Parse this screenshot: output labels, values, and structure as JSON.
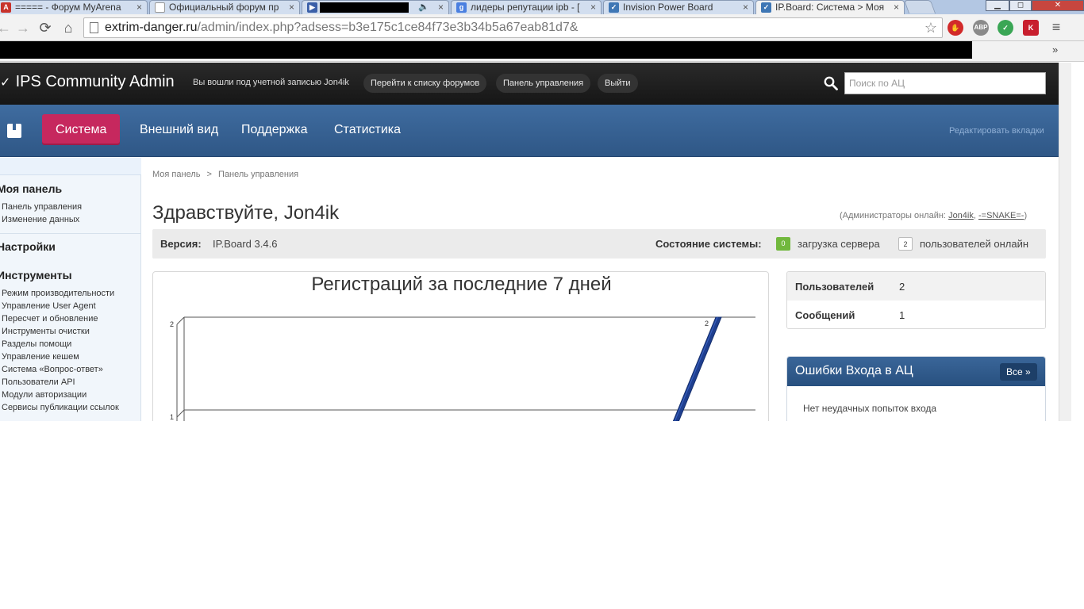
{
  "browser": {
    "tabs": [
      {
        "title": "===== - Форум MyArena",
        "favicon": "myarena-icon",
        "favicon_color": "#c8332b",
        "active": false
      },
      {
        "title": "Официальный форум пр",
        "favicon": "page-icon",
        "favicon_color": "#ffffff",
        "active": false
      },
      {
        "title": "",
        "favicon": "play-icon",
        "favicon_color": "#3a5fa8",
        "active": false,
        "redacted": true,
        "audio": "🔈"
      },
      {
        "title": "лидеры репутации ipb - [",
        "favicon": "google-icon",
        "favicon_color": "#4a7fe0",
        "active": false
      },
      {
        "title": "Invision Power Board",
        "favicon": "ipb-icon",
        "favicon_color": "#3f77b5",
        "active": false
      },
      {
        "title": "IP.Board: Система > Моя",
        "favicon": "ipb-icon",
        "favicon_color": "#3f77b5",
        "active": true
      }
    ],
    "tab_close": "×",
    "window_buttons": [
      "▁",
      "◻",
      "✕"
    ],
    "url": "extrim-danger.ru/admin/index.php?adsess=b3e175c1ce84f73e3b34b5a67eab81d7&",
    "url_domain": "extrim-danger.ru",
    "url_path": "/admin/index.php?adsess=b3e175c1ce84f73e3b34b5a67eab81d7&",
    "extensions": [
      {
        "name": "adblock-icon",
        "label": "",
        "color": "#d22a2a"
      },
      {
        "name": "abp-icon",
        "label": "ABP",
        "color": "#8a8a8a"
      },
      {
        "name": "shield-check-icon",
        "label": "✓",
        "color": "#3aa655"
      },
      {
        "name": "kaspersky-icon",
        "label": "K",
        "color": "#c81f2e"
      }
    ],
    "bookmarks_more": "»"
  },
  "header": {
    "logo": "IPS Community Admin",
    "logged_in": "Вы вошли под учетной записью Jon4ik",
    "buttons": {
      "forums": "Перейти к списку форумов",
      "panel": "Панель управления",
      "logout": "Выйти"
    },
    "search_placeholder": "Поиск по АЦ"
  },
  "nav": {
    "tabs": [
      "Система",
      "Внешний вид",
      "Поддержка",
      "Статистика"
    ],
    "active": "Система",
    "edit_tabs": "Редактировать вкладки"
  },
  "sidebar": {
    "sections": [
      {
        "title": "Моя панель",
        "items": [
          "Панель управления",
          "Изменение данных"
        ]
      },
      {
        "title": "Настройки",
        "items": []
      },
      {
        "title": "Инструменты",
        "items": [
          "Режим производительности",
          "Управление User Agent",
          "Пересчет и обновление",
          "Инструменты очистки",
          "Разделы помощи",
          "Управление кешем",
          "Система «Вопрос-ответ»",
          "Пользователи API",
          "Модули авторизации",
          "Сервисы публикации ссылок"
        ]
      }
    ]
  },
  "main": {
    "breadcrumb": {
      "first": "Моя панель",
      "separator": ">",
      "second": "Панель управления"
    },
    "title": "Здравствуйте, Jon4ik",
    "admins_online": {
      "prefix": "(Администраторы онлайн: ",
      "users": [
        "Jon4ik",
        "-=SNAKE=-"
      ],
      "sep": ", ",
      "suffix": ")"
    },
    "version_label": "Версия:",
    "version_value": "IP.Board 3.4.6",
    "status_label": "Состояние системы:",
    "server_load_value": "0",
    "server_load_label": "загрузка сервера",
    "users_online_value": "2",
    "users_online_label": "пользователей онлайн"
  },
  "stats": [
    {
      "label": "Пользователей",
      "value": "2"
    },
    {
      "label": "Сообщений",
      "value": "1"
    }
  ],
  "login_errors": {
    "title": "Ошибки Входа в АЦ",
    "all_button": "Все »",
    "empty": "Нет неудачных попыток входа"
  },
  "colors": {
    "accent": "#c6285e",
    "nav": "#3a6699",
    "header": "#1f1f1f",
    "line": "#1f3f8f"
  },
  "chart_data": {
    "type": "line",
    "title": "Регистраций за последние 7 дней",
    "ytick_labels": [
      "2",
      "1"
    ],
    "ylim": [
      0,
      2
    ],
    "series": [
      {
        "points": [
          {
            "x": 6,
            "y": 0
          },
          {
            "x": 7,
            "y": 2
          }
        ]
      }
    ],
    "xlim": [
      0,
      7
    ],
    "data_labels": [
      "2"
    ],
    "grid": true,
    "three_d": true
  }
}
